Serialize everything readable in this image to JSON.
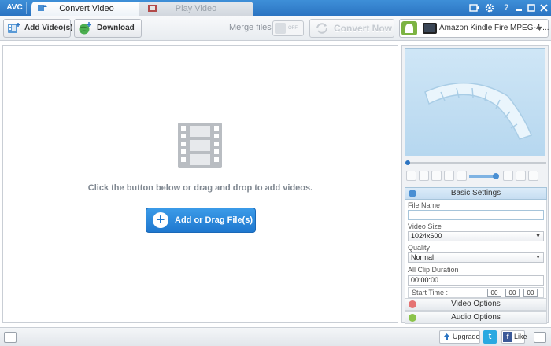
{
  "app": {
    "logo": "AVC",
    "window_controls": [
      "screen-recorder-icon",
      "settings-gear-icon",
      "help-icon",
      "minimize-icon",
      "maximize-icon",
      "close-icon"
    ]
  },
  "tabs": [
    {
      "label": "Convert Video",
      "active": true
    },
    {
      "label": "Play Video",
      "active": false
    }
  ],
  "toolbar": {
    "add_videos_label": "Add Video(s)",
    "download_label": "Download",
    "merge_label": "Merge files",
    "merge_state": "OFF",
    "convert_now_label": "Convert Now",
    "profile_label": "Amazon Kindle Fire MPEG-4 ..."
  },
  "main": {
    "hint": "Click the button below or drag and drop to add videos.",
    "add_drag_label": "Add or Drag File(s)"
  },
  "settings": {
    "basic_title": "Basic Settings",
    "file_name_label": "File Name",
    "file_name_value": "",
    "video_size_label": "Video Size",
    "video_size_value": "1024x600",
    "quality_label": "Quality",
    "quality_value": "Normal",
    "clip_duration_label": "All Clip Duration",
    "clip_duration_value": "00:00:00",
    "start_time_label": "Start Time :",
    "start_time": [
      "00",
      "00",
      "00"
    ],
    "video_options_label": "Video Options",
    "audio_options_label": "Audio Options"
  },
  "status": {
    "upgrade_label": "Upgrade",
    "like_label": "Like",
    "twitter_glyph": "t",
    "facebook_glyph": "f"
  },
  "colors": {
    "titlebar": "#2b74c2",
    "add_button": "#1f78cf",
    "preview_bg": "#cfe6f6"
  }
}
